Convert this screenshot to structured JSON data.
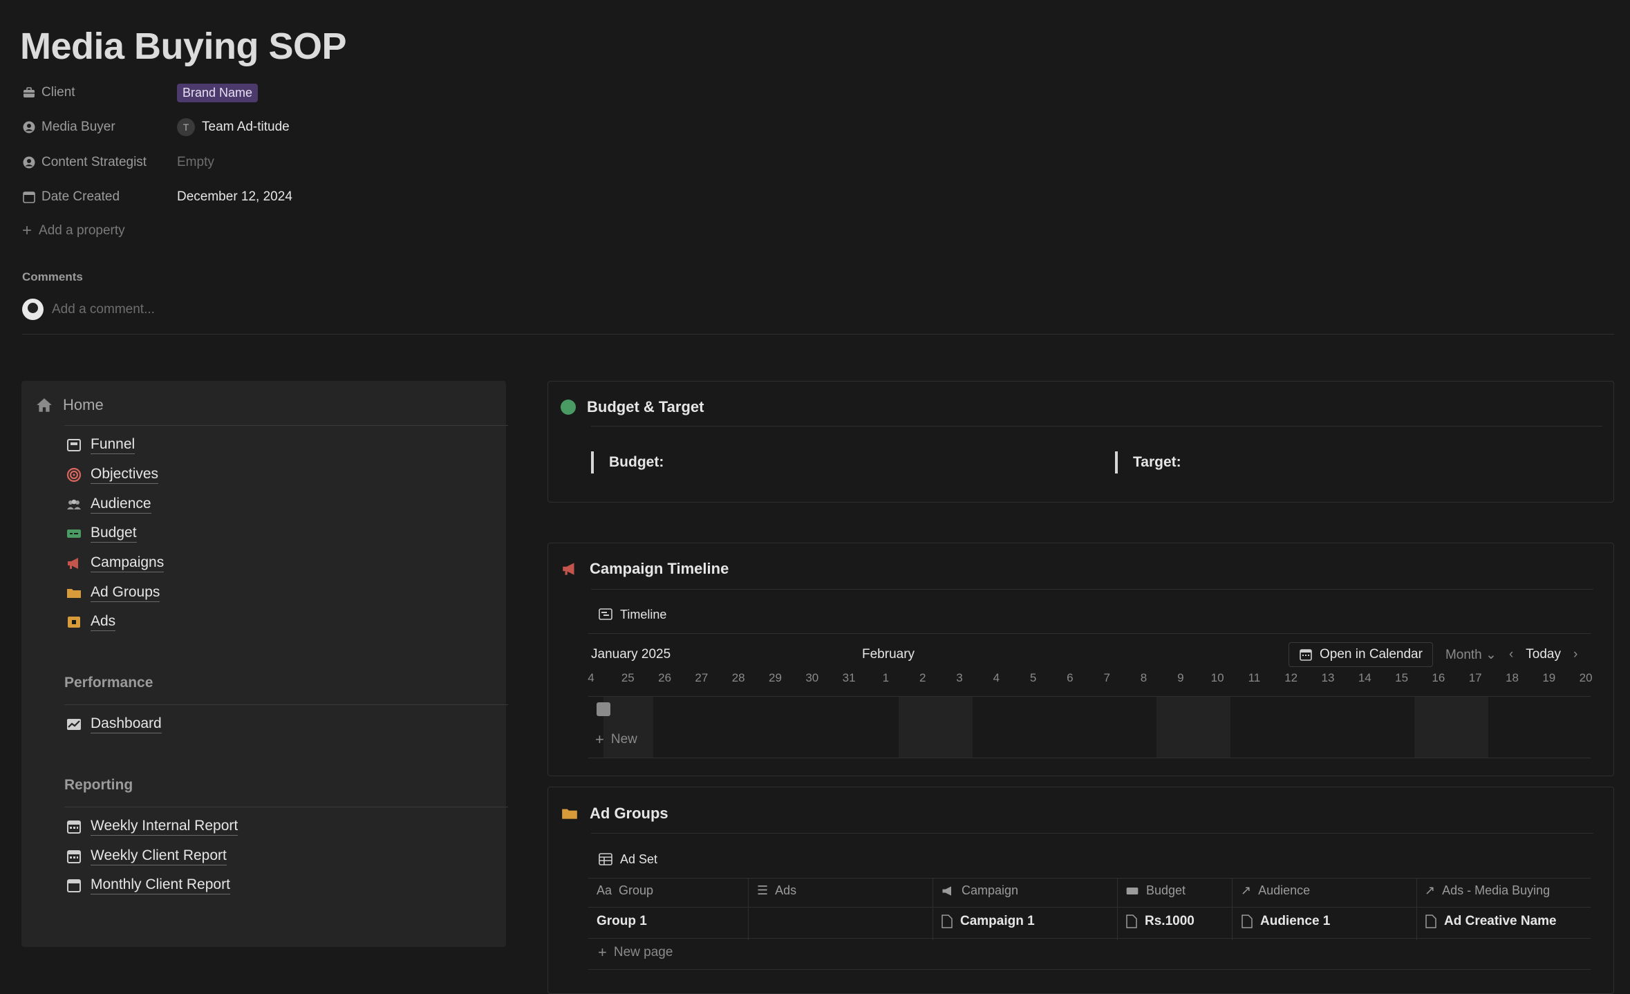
{
  "page": {
    "title": "Media Buying SOP"
  },
  "properties": [
    {
      "label": "Client",
      "value": "Brand Name",
      "type": "tag"
    },
    {
      "label": "Media Buyer",
      "value": "Team Ad-titude",
      "avatar_initial": "T"
    },
    {
      "label": "Content Strategist",
      "value": "Empty"
    },
    {
      "label": "Date Created",
      "value": "December 12, 2024"
    }
  ],
  "add_property": "Add a property",
  "comments": {
    "label": "Comments",
    "placeholder": "Add a comment..."
  },
  "nav": {
    "home": "Home",
    "items": [
      "Funnel",
      "Objectives",
      "Audience",
      "Budget",
      "Campaigns",
      "Ad Groups",
      "Ads"
    ],
    "performance": {
      "title": "Performance",
      "items": [
        "Dashboard"
      ]
    },
    "reporting": {
      "title": "Reporting",
      "items": [
        "Weekly Internal Report",
        "Weekly Client Report",
        "Monthly Client Report"
      ]
    }
  },
  "budget_target": {
    "title": "Budget & Target",
    "budget_label": "Budget:",
    "target_label": "Target:",
    "accent": "#4a9a63"
  },
  "campaign_timeline": {
    "title": "Campaign Timeline",
    "view_tab": "Timeline",
    "month_left": "January 2025",
    "month_right": "February",
    "days": [
      "4",
      "25",
      "26",
      "27",
      "28",
      "29",
      "30",
      "31",
      "1",
      "2",
      "3",
      "4",
      "5",
      "6",
      "7",
      "8",
      "9",
      "10",
      "11",
      "12",
      "13",
      "14",
      "15",
      "16",
      "17",
      "18",
      "19",
      "20"
    ],
    "open_calendar": "Open in Calendar",
    "period": "Month",
    "today": "Today",
    "new_label": "New"
  },
  "ad_groups": {
    "title": "Ad Groups",
    "view_tab": "Ad Set",
    "columns": [
      "Group",
      "Ads",
      "Campaign",
      "Budget",
      "Audience",
      "Ads - Media Buying"
    ],
    "rows": [
      {
        "group": "Group 1",
        "ads": "",
        "campaign": "Campaign 1",
        "budget": "Rs.1000",
        "audience": "Audience 1",
        "ads_media": "Ad Creative Name"
      }
    ],
    "new_page": "New page"
  },
  "colors": {
    "background": "#191919",
    "panel": "#252525",
    "tag_bg": "#4b3a6b",
    "campaign_icon": "#c4554d",
    "folder_icon": "#d89b3a"
  }
}
